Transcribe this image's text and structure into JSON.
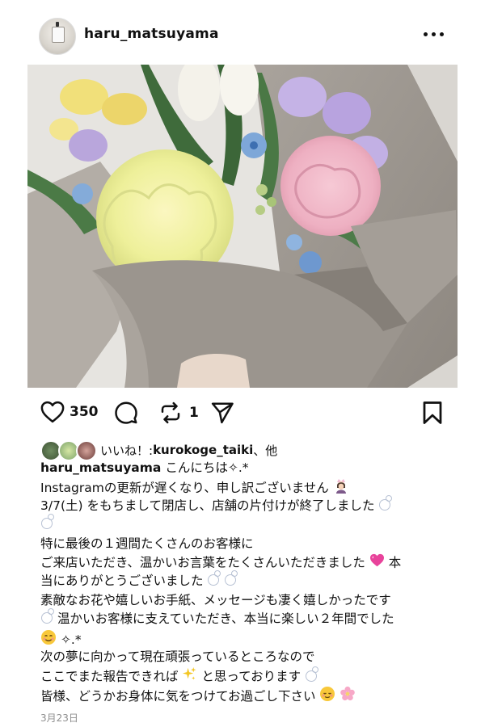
{
  "post": {
    "username": "haru_matsuyama",
    "image_alt": "flower bouquet",
    "like_count": "350",
    "repost_count": "1",
    "liked_by_prefix": "いいね！: ",
    "liked_by_user": "kurokoge_taiki",
    "liked_by_suffix": "、他",
    "caption_lines": [
      "こんにちは✧.*",
      "Instagramの更新が遅くなり、申し訳ございません",
      "3/7(土) をもちまして閉店し、店舗の片付けが終了しました",
      "",
      "特に最後の１週間たくさんのお客様に",
      "ご来店いただき、温かいお言葉をたくさんいただきました",
      "本",
      "当にありがとうございました",
      "素敵なお花や嬉しいお手紙、メッセージも凄く嬉しかったです",
      "温かいお客様に支えていただき、本当に楽しい２年間でした",
      "✧.*",
      "次の夢に向かって現在頑張っているところなので",
      "ここでまた報告できれば",
      "と思っております",
      "皆様、どうかお身体に気をつけてお過ごし下さい"
    ],
    "date": "3月23日"
  },
  "icons": {
    "like": "heart-icon",
    "comment": "comment-icon",
    "repost": "repost-icon",
    "share": "send-icon",
    "save": "bookmark-icon",
    "more": "more-dots-icon"
  },
  "colors": {
    "text": "#111111",
    "muted": "#8e8e8e",
    "heart_emoji": "#e8439b",
    "sparkle": "#f3c623"
  }
}
